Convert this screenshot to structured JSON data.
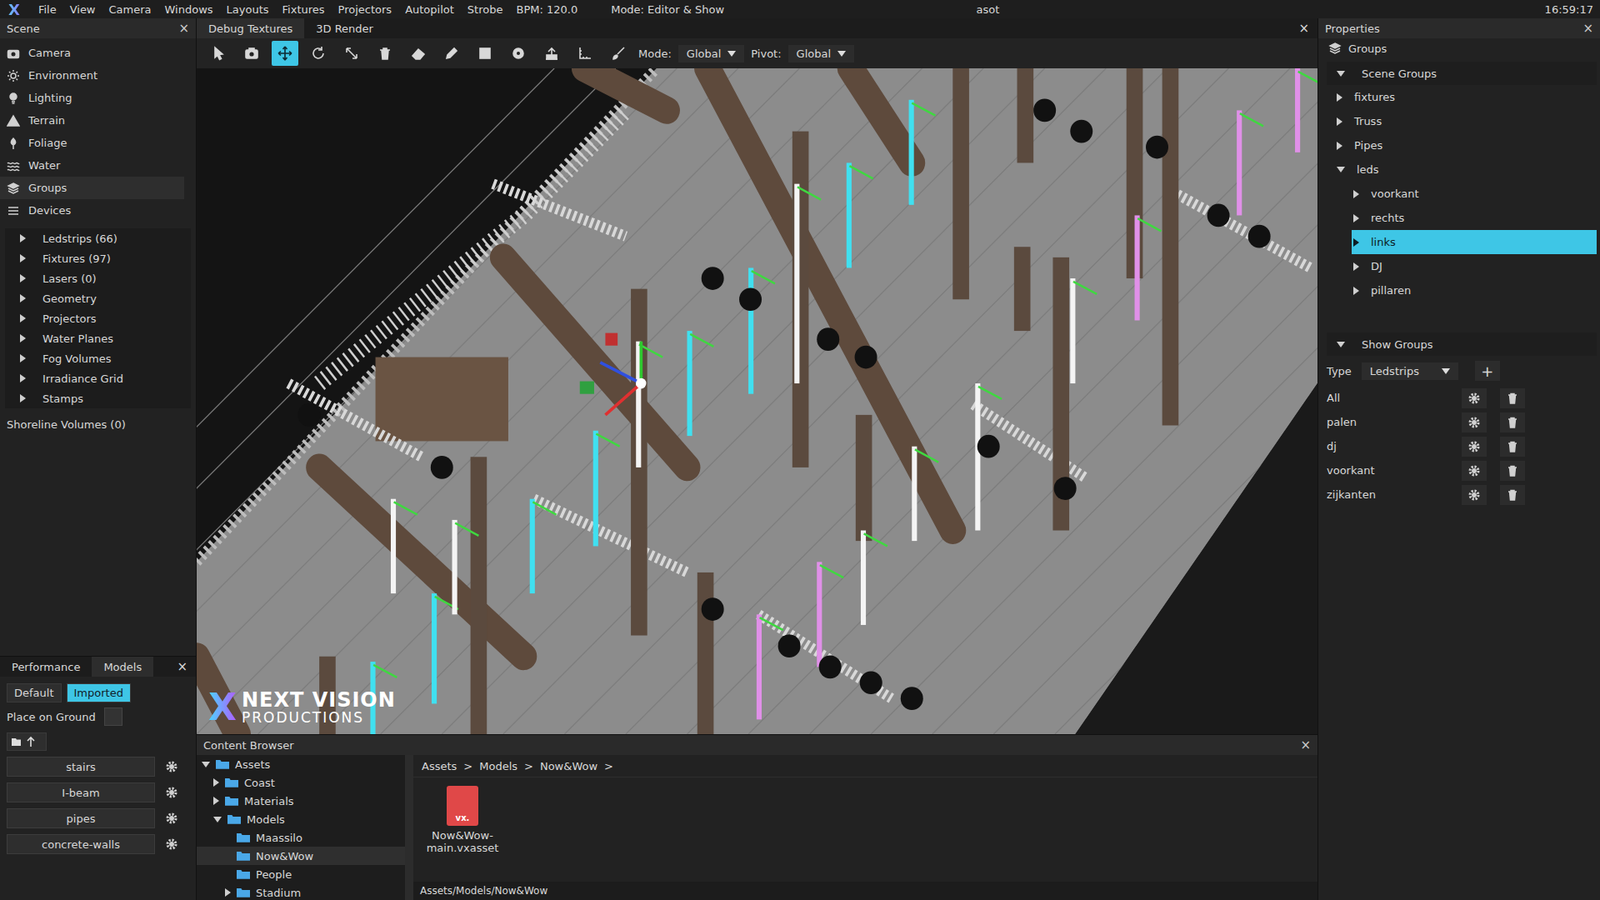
{
  "menu_bar": {
    "logo": "X",
    "items": [
      "File",
      "View",
      "Camera",
      "Windows",
      "Layouts",
      "Fixtures",
      "Projectors",
      "Autopilot",
      "Strobe"
    ],
    "bpm": "BPM: 120.0",
    "mode": "Mode: Editor & Show",
    "project": "asot",
    "clock": "16:59:17"
  },
  "scene": {
    "title": "Scene",
    "close": "×",
    "items": [
      {
        "label": "Camera",
        "kind": "camera",
        "selected": false
      },
      {
        "label": "Environment",
        "kind": "environment",
        "selected": false
      },
      {
        "label": "Lighting",
        "kind": "lighting",
        "selected": false
      },
      {
        "label": "Terrain",
        "kind": "terrain",
        "selected": false
      },
      {
        "label": "Foliage",
        "kind": "foliage",
        "selected": false
      },
      {
        "label": "Water",
        "kind": "water",
        "selected": false
      },
      {
        "label": "Groups",
        "kind": "groups",
        "selected": true
      },
      {
        "label": "Devices",
        "kind": "devices",
        "selected": false
      }
    ],
    "tree": [
      {
        "label": "Ledstrips (66)",
        "expanded": false
      },
      {
        "label": "Fixtures (97)",
        "expanded": false
      },
      {
        "label": "Lasers (0)",
        "expanded": false
      },
      {
        "label": "Geometry",
        "expanded": false
      },
      {
        "label": "Projectors",
        "expanded": false
      },
      {
        "label": "Water Planes",
        "expanded": false
      },
      {
        "label": "Fog Volumes",
        "expanded": false
      },
      {
        "label": "Irradiance Grid",
        "expanded": false
      },
      {
        "label": "Stamps",
        "expanded": false
      }
    ],
    "shoreline": "Shoreline Volumes (0)"
  },
  "models_panel": {
    "tabs": [
      {
        "label": "Performance",
        "selected": false
      },
      {
        "label": "Models",
        "selected": true
      }
    ],
    "close": "×",
    "filters": [
      {
        "label": "Default",
        "selected": false
      },
      {
        "label": "Imported",
        "selected": true
      }
    ],
    "place_on_ground": {
      "label": "Place on Ground",
      "checked": false
    },
    "models": [
      "stairs",
      "I-beam",
      "pipes",
      "concrete-walls"
    ]
  },
  "viewport": {
    "tabs": [
      {
        "label": "Debug Textures",
        "selected": true
      },
      {
        "label": "3D Render",
        "selected": false
      }
    ],
    "close": "×",
    "tools": [
      {
        "kind": "select",
        "selected": false
      },
      {
        "kind": "camera",
        "selected": false
      },
      {
        "kind": "move",
        "selected": true
      },
      {
        "kind": "rotate",
        "selected": false
      },
      {
        "kind": "scale",
        "selected": false
      },
      {
        "kind": "delete",
        "selected": false
      },
      {
        "kind": "erase",
        "selected": false
      },
      {
        "kind": "pencil",
        "selected": false
      },
      {
        "kind": "square",
        "selected": false
      },
      {
        "kind": "circle",
        "selected": false
      },
      {
        "kind": "upload",
        "selected": false
      },
      {
        "kind": "ruler",
        "selected": false
      },
      {
        "kind": "brush",
        "selected": false
      }
    ],
    "mode_label": "Mode:",
    "mode_value": "Global",
    "pivot_label": "Pivot:",
    "pivot_value": "Global",
    "watermark": {
      "logo": "X",
      "line1": "NEXT VISION",
      "line2": "PRODUCTIONS"
    }
  },
  "content_browser": {
    "title": "Content Browser",
    "close": "×",
    "tree": [
      {
        "label": "Assets",
        "has_children": true,
        "expanded": true,
        "selected": false,
        "children": [
          {
            "label": "Coast",
            "has_children": true,
            "expanded": false,
            "selected": false,
            "children": []
          },
          {
            "label": "Materials",
            "has_children": true,
            "expanded": false,
            "selected": false,
            "children": []
          },
          {
            "label": "Models",
            "has_children": true,
            "expanded": true,
            "selected": false,
            "children": [
              {
                "label": "Maassilo",
                "has_children": false,
                "expanded": false,
                "selected": false,
                "children": []
              },
              {
                "label": "Now&Wow",
                "has_children": false,
                "expanded": false,
                "selected": true,
                "children": []
              },
              {
                "label": "People",
                "has_children": false,
                "expanded": false,
                "selected": false,
                "children": []
              },
              {
                "label": "Stadium",
                "has_children": true,
                "expanded": false,
                "selected": false,
                "children": []
              }
            ]
          }
        ]
      }
    ],
    "breadcrumb": [
      "Assets",
      "Models",
      "Now&Wow"
    ],
    "breadcrumb_sep": ">",
    "files": [
      {
        "name": "Now&Wow-main.vxasset",
        "badge": "vx."
      }
    ],
    "path": "Assets/Models/Now&Wow"
  },
  "properties": {
    "title": "Properties",
    "close": "×",
    "section": "Groups",
    "scene_groups": {
      "title": "Scene Groups",
      "expanded": true,
      "items": [
        {
          "label": "fixtures",
          "expanded": false,
          "selected": false,
          "children": []
        },
        {
          "label": "Truss",
          "expanded": false,
          "selected": false,
          "children": []
        },
        {
          "label": "Pipes",
          "expanded": false,
          "selected": false,
          "children": []
        },
        {
          "label": "leds",
          "expanded": true,
          "selected": false,
          "children": [
            {
              "label": "voorkant",
              "expanded": false,
              "selected": false,
              "children": []
            },
            {
              "label": "rechts",
              "expanded": false,
              "selected": false,
              "children": []
            },
            {
              "label": "links",
              "expanded": false,
              "selected": true,
              "children": []
            },
            {
              "label": "DJ",
              "expanded": false,
              "selected": false,
              "children": []
            },
            {
              "label": "pillaren",
              "expanded": false,
              "selected": false,
              "children": []
            }
          ]
        }
      ]
    },
    "show_groups": {
      "title": "Show Groups",
      "expanded": true,
      "type_label": "Type",
      "type_value": "Ledstrips",
      "add": "+",
      "rows": [
        "All",
        "palen",
        "dj",
        "voorkant",
        "zijkanten"
      ]
    }
  }
}
